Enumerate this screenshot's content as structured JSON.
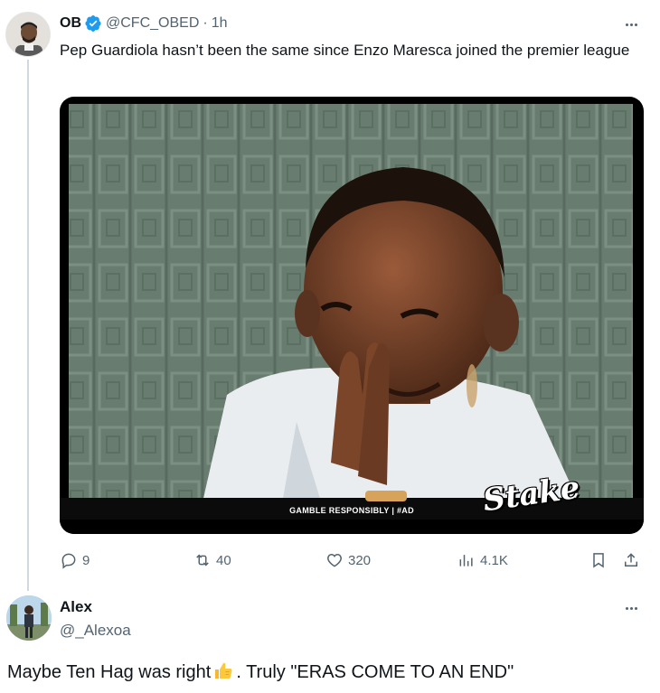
{
  "tweet": {
    "author_name": "OB",
    "handle": "@CFC_OBED",
    "separator": "·",
    "time": "1h",
    "text": "Pep Guardiola hasn’t been the same since Enzo Maresca joined the premier league",
    "media": {
      "banner_text": "GAMBLE RESPONSIBLY  |  #AD",
      "watermark": "Stake"
    },
    "stats": {
      "replies": "9",
      "reposts": "40",
      "likes": "320",
      "views": "4.1K"
    }
  },
  "reply": {
    "author_name": "Alex",
    "handle": "@_Alexoa",
    "text_before": "Maybe Ten Hag was right",
    "text_after": ". Truly \"ERAS COME TO AN END\""
  },
  "colors": {
    "text_primary": "#0f1419",
    "text_secondary": "#536471",
    "verified_blue": "#1d9bf0",
    "thread_line": "#cfd9de"
  }
}
